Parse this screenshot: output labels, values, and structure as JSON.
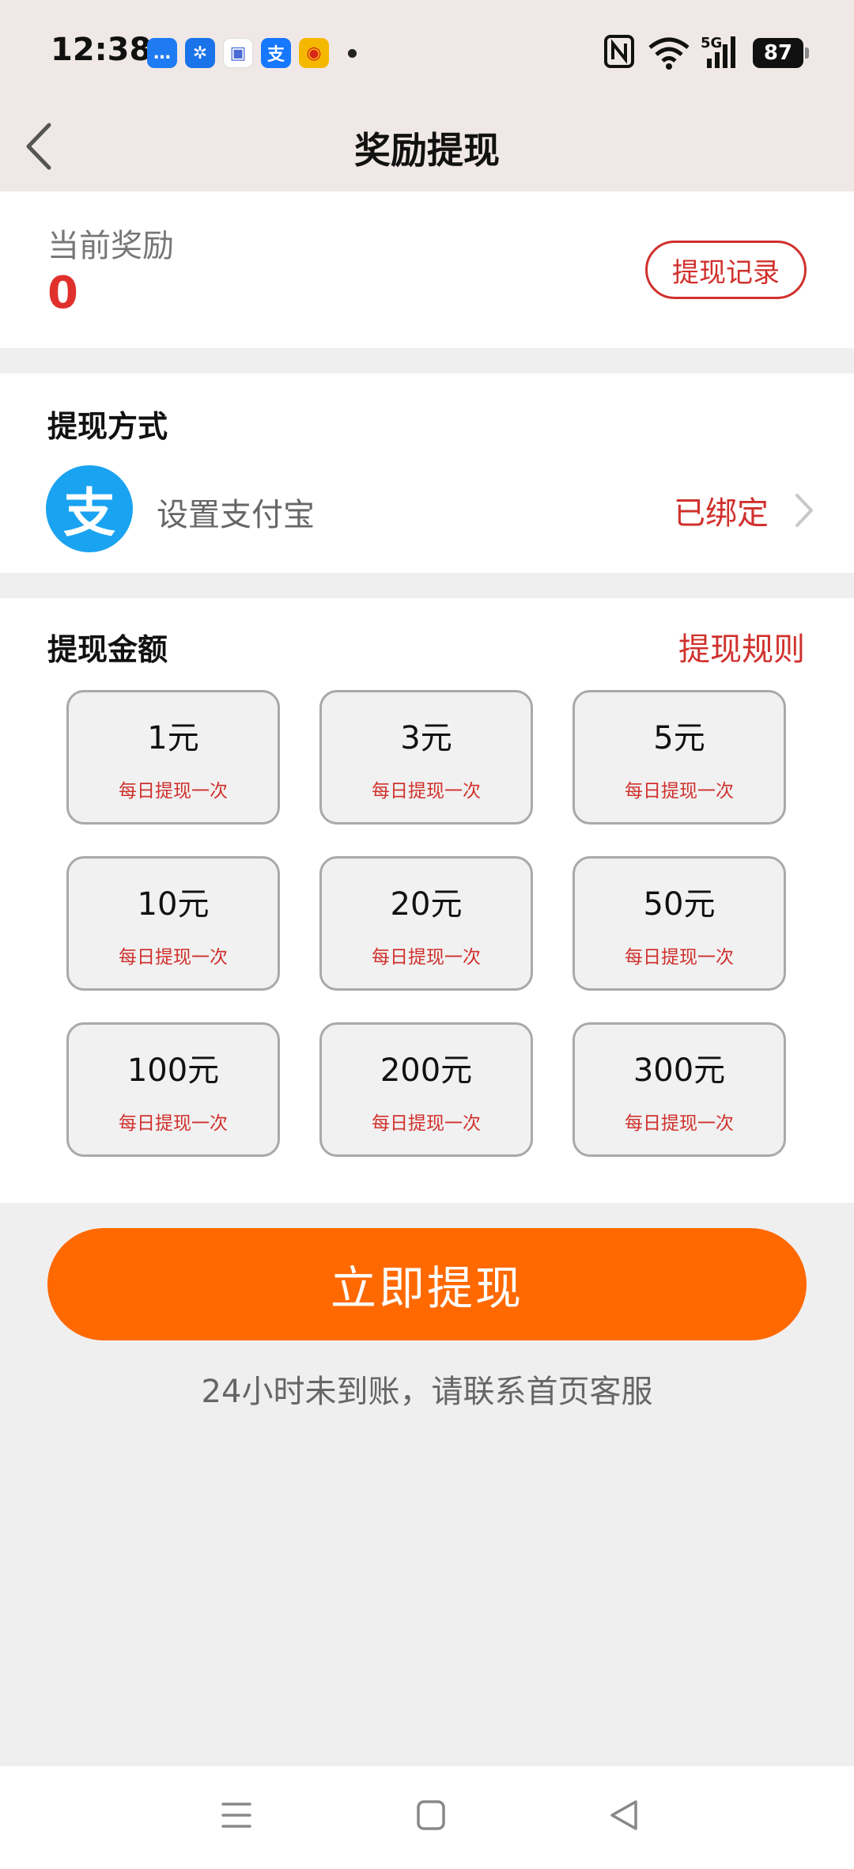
{
  "status_bar": {
    "time": "12:38",
    "notifications": [
      {
        "name": "messages-icon",
        "color": "#1f7bf2",
        "glyph": "…"
      },
      {
        "name": "pinwheel-app-icon",
        "color": "#1a73e8",
        "glyph": "✲"
      },
      {
        "name": "chat-app-icon",
        "color": "#ffffff",
        "glyph": "▣"
      },
      {
        "name": "alipay-notif-icon",
        "color": "#1677ff",
        "glyph": "支"
      },
      {
        "name": "weibo-icon",
        "color": "#f5b800",
        "glyph": "◉"
      }
    ],
    "network": "5G",
    "battery": "87"
  },
  "nav": {
    "title": "奖励提现"
  },
  "reward": {
    "label": "当前奖励",
    "value": "0",
    "record_button": "提现记录"
  },
  "method": {
    "title": "提现方式",
    "logo_glyph": "支",
    "label": "设置支付宝",
    "status": "已绑定"
  },
  "amount": {
    "title": "提现金额",
    "rules_link": "提现规则",
    "options": [
      {
        "amount": "1元",
        "note": "每日提现一次"
      },
      {
        "amount": "3元",
        "note": "每日提现一次"
      },
      {
        "amount": "5元",
        "note": "每日提现一次"
      },
      {
        "amount": "10元",
        "note": "每日提现一次"
      },
      {
        "amount": "20元",
        "note": "每日提现一次"
      },
      {
        "amount": "50元",
        "note": "每日提现一次"
      },
      {
        "amount": "100元",
        "note": "每日提现一次"
      },
      {
        "amount": "200元",
        "note": "每日提现一次"
      },
      {
        "amount": "300元",
        "note": "每日提现一次"
      }
    ]
  },
  "submit_label": "立即提现",
  "note": "24小时未到账，请联系首页客服",
  "colors": {
    "accent": "#ff6900",
    "red": "#d0312d",
    "alipay_blue": "#1aa3f0"
  }
}
